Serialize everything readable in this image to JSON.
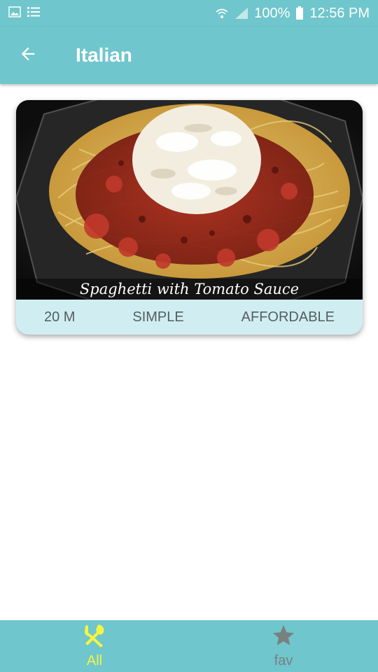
{
  "status_bar": {
    "left_icons": [
      "image-icon",
      "list-icon"
    ],
    "battery": "100%",
    "time": "12:56 PM",
    "right_icons": [
      "wifi-icon",
      "signal-icon",
      "battery-icon"
    ]
  },
  "app_bar": {
    "back_icon": "arrow-left-icon",
    "title": "Italian"
  },
  "meals": [
    {
      "title": "Spaghetti with Tomato Sauce",
      "duration": "20 M",
      "complexity": "SIMPLE",
      "affordability": "AFFORDABLE"
    }
  ],
  "bottom_nav": {
    "items": [
      {
        "label": "All",
        "icon": "utensils-icon",
        "active": true
      },
      {
        "label": "fav",
        "icon": "star-icon",
        "active": false
      }
    ]
  },
  "colors": {
    "primary": "#6fc6cc",
    "card_footer": "#d0eef2",
    "nav_active": "#f5f542",
    "nav_inactive": "#7a7f80",
    "meta_text": "#555d60"
  }
}
